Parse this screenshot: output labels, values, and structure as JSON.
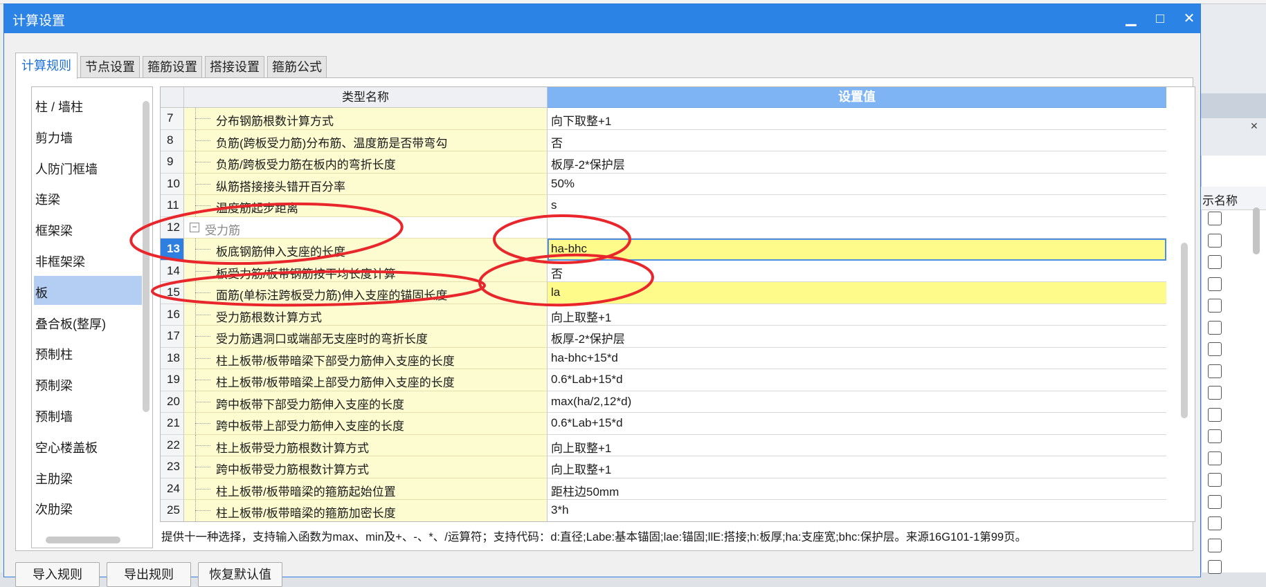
{
  "window": {
    "title": "计算设置",
    "minimize_glyph": "▁",
    "maximize_glyph": "□",
    "close_glyph": "✕"
  },
  "tabs": [
    {
      "label": "计算规则",
      "active": true
    },
    {
      "label": "节点设置",
      "active": false
    },
    {
      "label": "箍筋设置",
      "active": false
    },
    {
      "label": "搭接设置",
      "active": false
    },
    {
      "label": "箍筋公式",
      "active": false
    }
  ],
  "component_list": {
    "selected": "板",
    "items": [
      "柱 / 墙柱",
      "剪力墙",
      "人防门框墙",
      "连梁",
      "框架梁",
      "非框架梁",
      "板",
      "叠合板(整厚)",
      "预制柱",
      "预制梁",
      "预制墙",
      "空心楼盖板",
      "主肋梁",
      "次肋梁"
    ]
  },
  "grid": {
    "header_name": "类型名称",
    "header_value": "设置值",
    "rows": [
      {
        "num": "7",
        "name": "分布钢筋根数计算方式",
        "value": "向下取整+1"
      },
      {
        "num": "8",
        "name": "负筋(跨板受力筋)分布筋、温度筋是否带弯勾",
        "value": "否"
      },
      {
        "num": "9",
        "name": "负筋/跨板受力筋在板内的弯折长度",
        "value": "板厚-2*保护层"
      },
      {
        "num": "10",
        "name": "纵筋搭接接头错开百分率",
        "value": "50%"
      },
      {
        "num": "11",
        "name": "温度筋起步距离",
        "value": "s"
      },
      {
        "num": "12",
        "name": "受力筋",
        "value": "",
        "group": true,
        "expand_glyph": "−"
      },
      {
        "num": "13",
        "name": "板底钢筋伸入支座的长度",
        "value": "ha-bhc",
        "current": true
      },
      {
        "num": "14",
        "name": "板受力筋/板带钢筋按平均长度计算",
        "value": "否"
      },
      {
        "num": "15",
        "name": "面筋(单标注跨板受力筋)伸入支座的锚固长度",
        "value": "la",
        "highlight": true
      },
      {
        "num": "16",
        "name": "受力筋根数计算方式",
        "value": "向上取整+1"
      },
      {
        "num": "17",
        "name": "受力筋遇洞口或端部无支座时的弯折长度",
        "value": "板厚-2*保护层"
      },
      {
        "num": "18",
        "name": "柱上板带/板带暗梁下部受力筋伸入支座的长度",
        "value": "ha-bhc+15*d"
      },
      {
        "num": "19",
        "name": "柱上板带/板带暗梁上部受力筋伸入支座的长度",
        "value": "0.6*Lab+15*d"
      },
      {
        "num": "20",
        "name": "跨中板带下部受力筋伸入支座的长度",
        "value": "max(ha/2,12*d)"
      },
      {
        "num": "21",
        "name": "跨中板带上部受力筋伸入支座的长度",
        "value": "0.6*Lab+15*d"
      },
      {
        "num": "22",
        "name": "柱上板带受力筋根数计算方式",
        "value": "向上取整+1"
      },
      {
        "num": "23",
        "name": "跨中板带受力筋根数计算方式",
        "value": "向上取整+1"
      },
      {
        "num": "24",
        "name": "柱上板带/板带暗梁的箍筋起始位置",
        "value": "距柱边50mm"
      },
      {
        "num": "25",
        "name": "柱上板带/板带暗梁的箍筋加密长度",
        "value": "3*h"
      }
    ]
  },
  "hint": "提供十一种选择，支持输入函数为max、min及+、-、*、/运算符；支持代码：d:直径;Labe:基本锚固;lae:锚固;llE:搭接;h:板厚;ha:支座宽;bhc:保护层。来源16G101-1第99页。",
  "buttons": {
    "import": "导入规则",
    "export": "导出规则",
    "restore": "恢复默认值"
  },
  "background_panel": {
    "header": "示名称"
  },
  "colors": {
    "titlebar": "#2c83e6",
    "value_header": "#7eb4f4",
    "highlight": "#fffb8a",
    "annotation": "#e8262b"
  }
}
